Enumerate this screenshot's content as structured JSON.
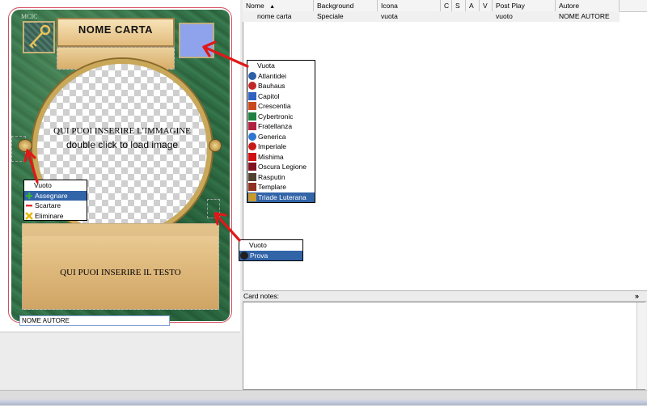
{
  "card": {
    "mcic_label": "MCIC",
    "title": "NOME CARTA",
    "image_placeholder": "QUI PUOI INSERIRE L’IMMAGINE",
    "image_hint": "double click to load image",
    "text_placeholder": "QUI PUOI INSERIRE IL TESTO",
    "author": "NOME AUTORE"
  },
  "image_menu": {
    "items": [
      {
        "label": "Vuoto",
        "icon": "none"
      },
      {
        "label": "Assegnare",
        "icon": "plus-icon",
        "selected": true
      },
      {
        "label": "Scartare",
        "icon": "minus-icon"
      },
      {
        "label": "Eliminare",
        "icon": "x-icon"
      }
    ]
  },
  "background_menu": {
    "items": [
      {
        "label": "Vuota"
      },
      {
        "label": "Atlantidei"
      },
      {
        "label": "Bauhaus"
      },
      {
        "label": "Capitol"
      },
      {
        "label": "Crescentia"
      },
      {
        "label": "Cybertronic"
      },
      {
        "label": "Fratellanza"
      },
      {
        "label": "Generica"
      },
      {
        "label": "Imperiale"
      },
      {
        "label": "Mishima"
      },
      {
        "label": "Oscura Legione"
      },
      {
        "label": "Rasputin"
      },
      {
        "label": "Templare"
      },
      {
        "label": "Triade Luterana",
        "selected": true
      }
    ]
  },
  "icon_menu": {
    "items": [
      {
        "label": "Vuoto"
      },
      {
        "label": "Prova",
        "selected": true
      }
    ]
  },
  "table": {
    "columns": [
      "Nome",
      "Background",
      "Icona",
      "C",
      "S",
      "A",
      "V",
      "Post Play",
      "Autore"
    ],
    "rows": [
      [
        "nome carta",
        "Speciale",
        "vuota",
        "",
        "",
        "",
        "",
        "vuoto",
        "NOME AUTORE"
      ]
    ]
  },
  "notes": {
    "title": "Card notes:",
    "collapse_glyph": "»",
    "value": ""
  },
  "colors": {
    "menu_selection": "#3264a8",
    "arrow": "#e01818",
    "card_green": "#2f6e46",
    "background_slot": "#8fa3ec"
  }
}
